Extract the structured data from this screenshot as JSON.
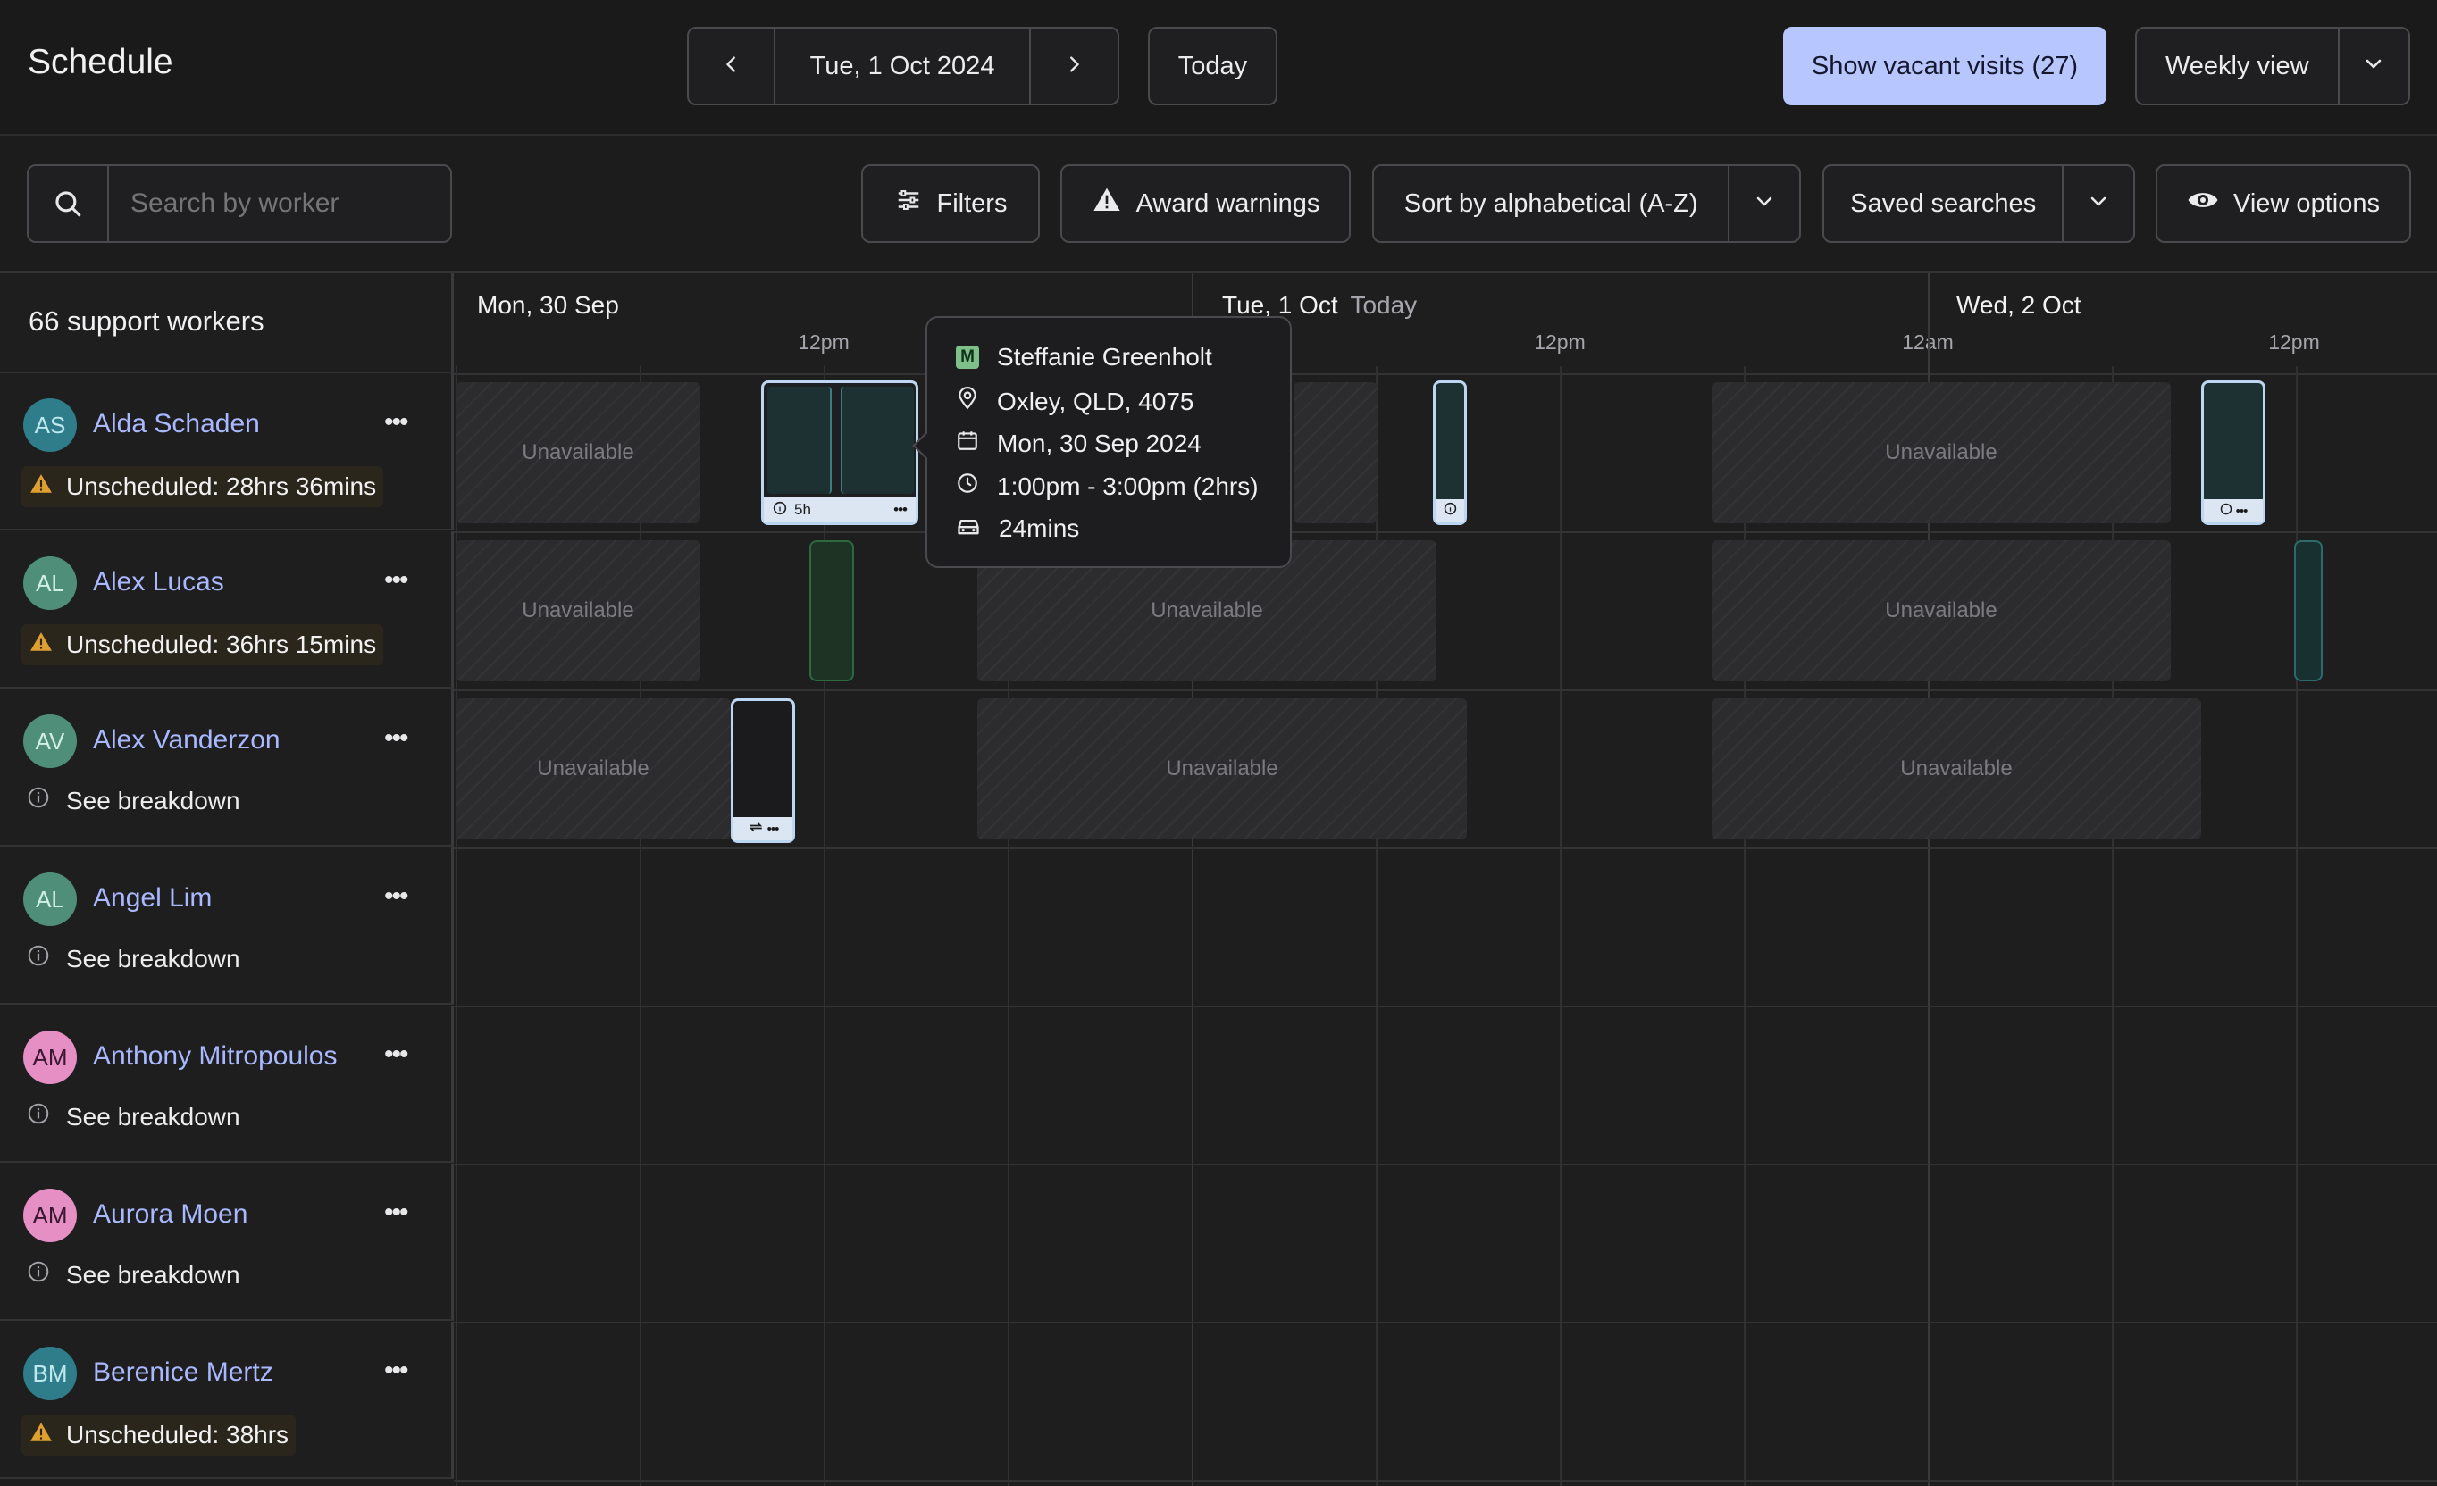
{
  "header": {
    "title": "Schedule",
    "current_date": "Tue, 1 Oct 2024",
    "today_label": "Today",
    "vacant_label": "Show vacant visits (27)",
    "view_label": "Weekly view"
  },
  "toolbar": {
    "search_placeholder": "Search by worker",
    "filters_label": "Filters",
    "award_label": "Award warnings",
    "sort_label": "Sort by alphabetical (A-Z)",
    "saved_label": "Saved searches",
    "view_options_label": "View options"
  },
  "sidebar": {
    "count_label": "66 support workers",
    "workers": [
      {
        "initials": "AS",
        "name": "Alda Schaden",
        "status_type": "warning",
        "status": "Unscheduled: 28hrs 36mins",
        "avatar_bg": "#2f7d8a",
        "avatar_fg": "#bfe8ef"
      },
      {
        "initials": "AL",
        "name": "Alex Lucas",
        "status_type": "warning",
        "status": "Unscheduled: 36hrs 15mins",
        "avatar_bg": "#4f8f7a",
        "avatar_fg": "#d2efe4"
      },
      {
        "initials": "AV",
        "name": "Alex Vanderzon",
        "status_type": "info",
        "status": "See breakdown",
        "avatar_bg": "#4f8f7a",
        "avatar_fg": "#d2efe4"
      },
      {
        "initials": "AL",
        "name": "Angel Lim",
        "status_type": "info",
        "status": "See breakdown",
        "avatar_bg": "#4f8f7a",
        "avatar_fg": "#d2efe4"
      },
      {
        "initials": "AM",
        "name": "Anthony Mitropoulos",
        "status_type": "info",
        "status": "See breakdown",
        "avatar_bg": "#e58fc4",
        "avatar_fg": "#3a1730"
      },
      {
        "initials": "AM",
        "name": "Aurora Moen",
        "status_type": "info",
        "status": "See breakdown",
        "avatar_bg": "#e58fc4",
        "avatar_fg": "#3a1730"
      },
      {
        "initials": "BM",
        "name": "Berenice Mertz",
        "status_type": "warning",
        "status": "Unscheduled: 38hrs",
        "avatar_bg": "#2f7d8a",
        "avatar_fg": "#bfe8ef"
      }
    ]
  },
  "timeline": {
    "days": [
      {
        "label": "Mon, 30 Sep",
        "tag": ""
      },
      {
        "label": "Tue, 1 Oct",
        "tag": "Today"
      },
      {
        "label": "Wed, 2 Oct",
        "tag": ""
      }
    ],
    "ticks": [
      "12pm",
      "12pm",
      "12am",
      "12pm"
    ],
    "unavailable_label": "Unavailable",
    "shift_duration_label": "5h"
  },
  "tooltip": {
    "client_badge": "M",
    "client_name": "Steffanie Greenholt",
    "location": "Oxley, QLD, 4075",
    "date": "Mon, 30 Sep 2024",
    "time": "1:00pm - 3:00pm (2hrs)",
    "travel": "24mins"
  },
  "colors": {
    "accent": "#a9b8ff",
    "vacant_button": "#b7c6ff",
    "warning": "#e0a030",
    "shift_border": "#bcd7f2",
    "shift_fill": "#1d3133",
    "shift_green": "#2a6a3e"
  }
}
